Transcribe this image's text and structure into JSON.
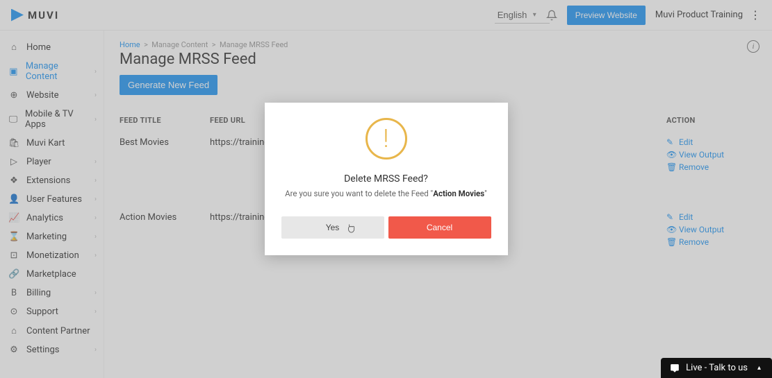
{
  "header": {
    "logo_text": "MUVI",
    "language": "English",
    "preview_label": "Preview Website",
    "user_label": "Muvi Product Training"
  },
  "sidebar": {
    "items": [
      {
        "icon": "⌂",
        "label": "Home",
        "has_children": false,
        "active": false
      },
      {
        "icon": "▣",
        "label": "Manage Content",
        "has_children": true,
        "active": true
      },
      {
        "icon": "⊕",
        "label": "Website",
        "has_children": true,
        "active": false
      },
      {
        "icon": "🖵",
        "label": "Mobile & TV Apps",
        "has_children": true,
        "active": false
      },
      {
        "icon": "🛍",
        "label": "Muvi Kart",
        "has_children": false,
        "active": false
      },
      {
        "icon": "▷",
        "label": "Player",
        "has_children": true,
        "active": false
      },
      {
        "icon": "❖",
        "label": "Extensions",
        "has_children": true,
        "active": false
      },
      {
        "icon": "👤",
        "label": "User Features",
        "has_children": true,
        "active": false
      },
      {
        "icon": "📈",
        "label": "Analytics",
        "has_children": true,
        "active": false
      },
      {
        "icon": "⌛",
        "label": "Marketing",
        "has_children": true,
        "active": false
      },
      {
        "icon": "⊡",
        "label": "Monetization",
        "has_children": true,
        "active": false
      },
      {
        "icon": "🔗",
        "label": "Marketplace",
        "has_children": false,
        "active": false
      },
      {
        "icon": "B",
        "label": "Billing",
        "has_children": true,
        "active": false
      },
      {
        "icon": "⊙",
        "label": "Support",
        "has_children": true,
        "active": false
      },
      {
        "icon": "⌂",
        "label": "Content Partner",
        "has_children": false,
        "active": false
      },
      {
        "icon": "⚙",
        "label": "Settings",
        "has_children": true,
        "active": false
      }
    ]
  },
  "breadcrumb": {
    "home": "Home",
    "mid": "Manage Content",
    "leaf": "Manage MRSS Feed"
  },
  "page": {
    "title": "Manage MRSS Feed",
    "generate_label": "Generate New Feed",
    "th_title": "FEED TITLE",
    "th_url": "FEED URL",
    "th_action": "ACTION",
    "action_edit": "Edit",
    "action_view": "View Output",
    "action_remove": "Remove"
  },
  "rows": [
    {
      "title": "Best Movies",
      "url": "https://training."
    },
    {
      "title": "Action Movies",
      "url": "https://training."
    }
  ],
  "modal": {
    "title": "Delete MRSS Feed?",
    "text_pre": "Are you sure you want to delete the Feed \"",
    "text_strong": "Action Movies",
    "text_post": "\"",
    "yes": "Yes",
    "cancel": "Cancel"
  },
  "chat": {
    "label": "Live - Talk to us"
  }
}
